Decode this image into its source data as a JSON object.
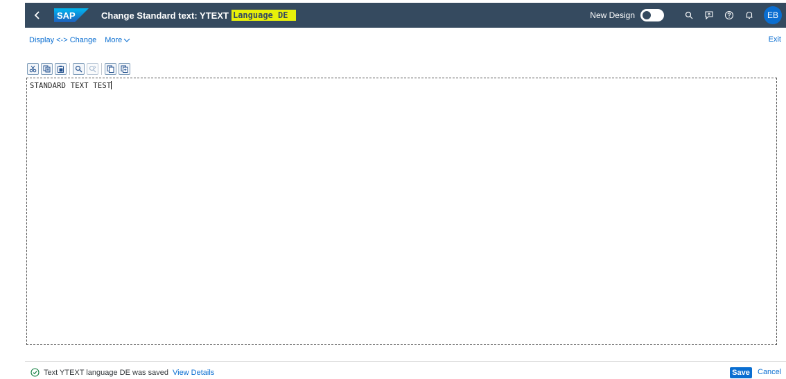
{
  "shell": {
    "logo_text": "SAP",
    "title_main": "Change Standard text: YTEXT",
    "title_highlight": "Language DE",
    "new_design_label": "New Design",
    "avatar_initials": "EB",
    "icons": [
      "back-icon",
      "search-icon",
      "feedback-icon",
      "help-icon",
      "notification-icon"
    ]
  },
  "subheader": {
    "display_change": "Display <-> Change",
    "more": "More",
    "exit": "Exit"
  },
  "toolbar": {
    "buttons": [
      "cut-icon",
      "copy-icon",
      "paste-icon",
      "find-icon",
      "find-next-icon",
      "copy-clipboard-icon",
      "paste-clipboard-icon"
    ]
  },
  "editor": {
    "content": "STANDARD TEXT TEST"
  },
  "footer": {
    "status_message": "Text YTEXT language DE was saved",
    "view_details": "View Details",
    "save": "Save",
    "cancel": "Cancel"
  },
  "colors": {
    "shell_bg": "#354a5f",
    "accent": "#0a6ed1",
    "highlight": "#e8f00a",
    "success": "#107e3e"
  }
}
